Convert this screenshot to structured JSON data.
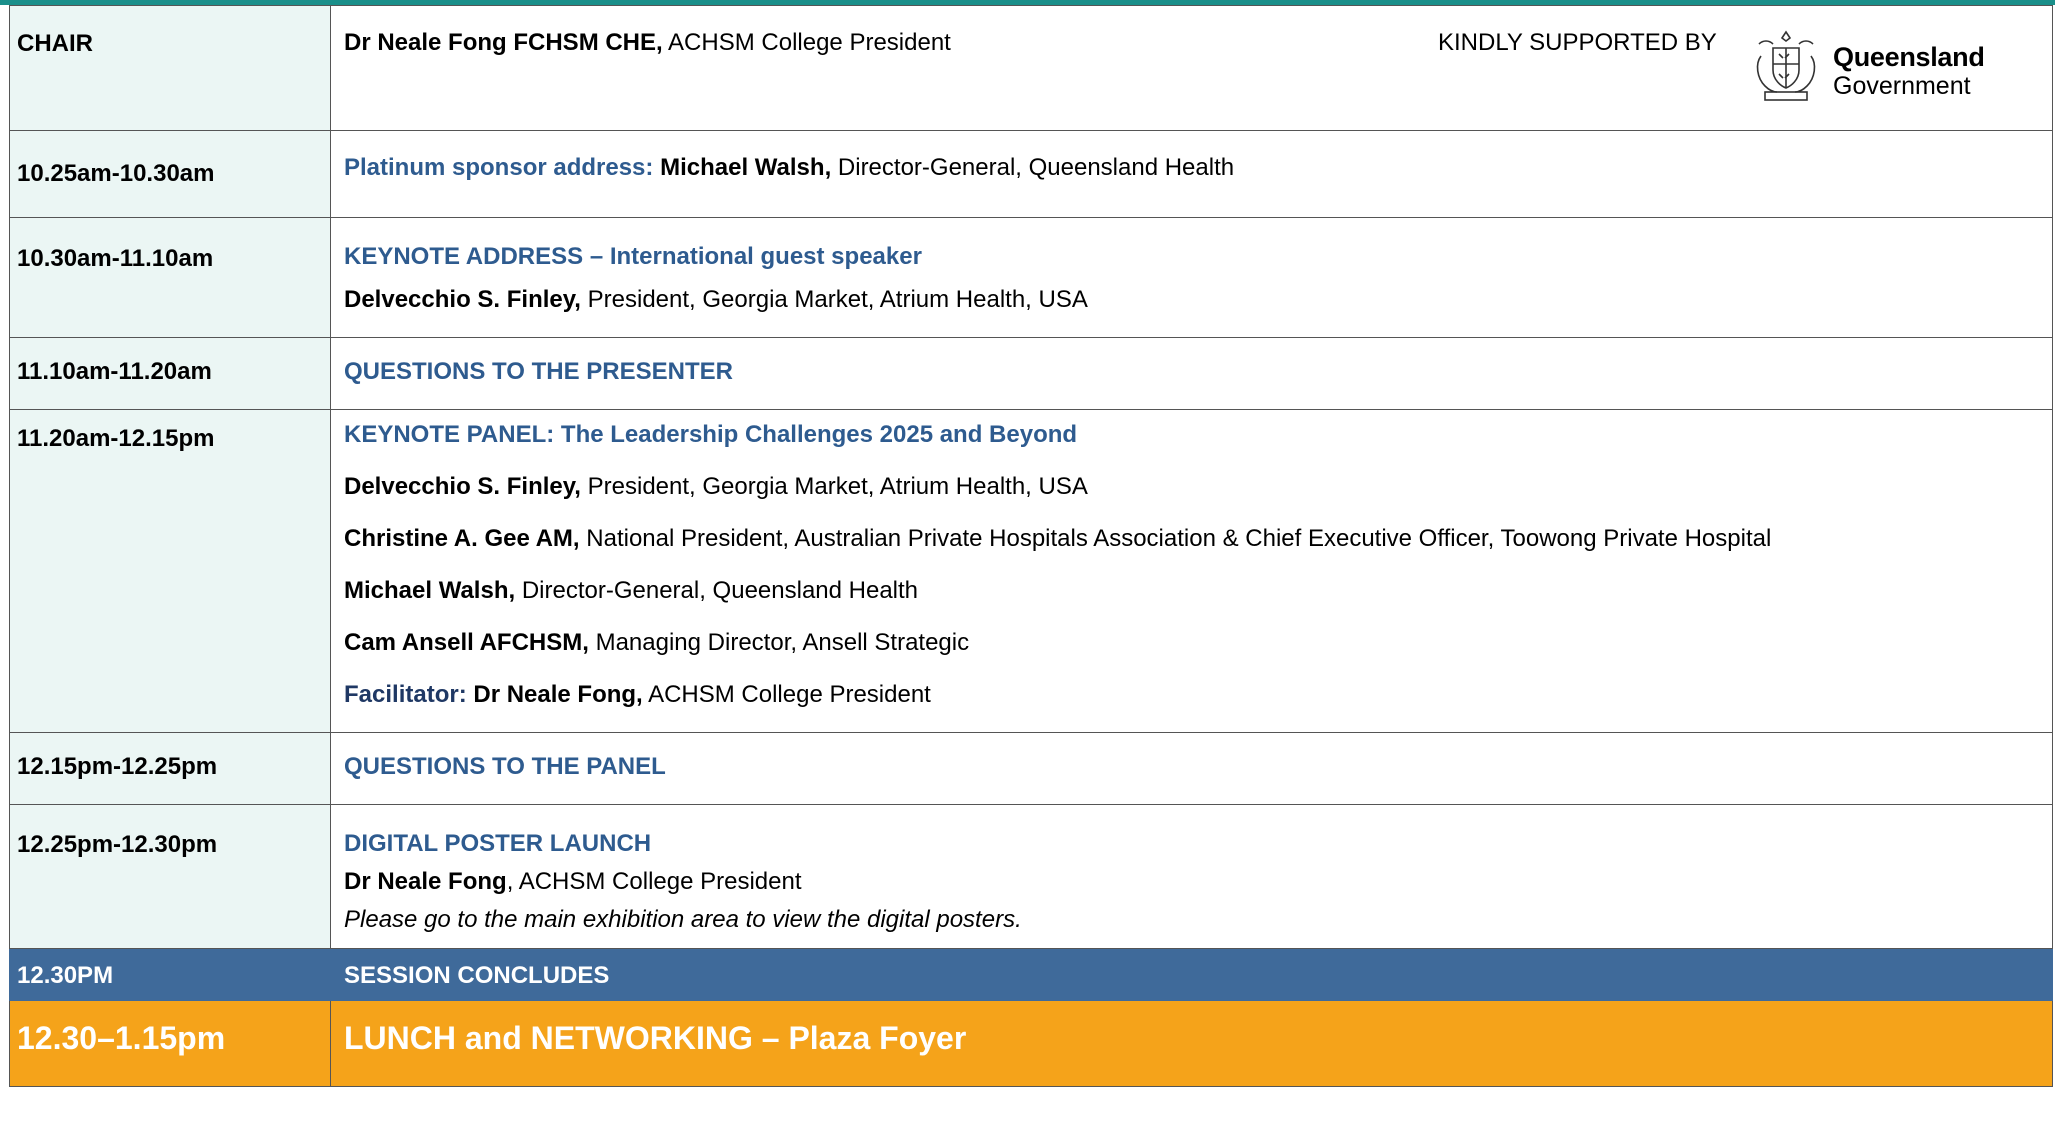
{
  "chair": {
    "label": "CHAIR",
    "name": "Dr Neale Fong FCHSM CHE,",
    "role": " ACHSM College President",
    "kindly": "KINDLY SUPPORTED BY",
    "sponsor_name": "Queensland",
    "sponsor_sub": "Government"
  },
  "rows": [
    {
      "time": "10.25am-10.30am",
      "l1_label": "Platinum sponsor address: ",
      "l1_name": "Michael Walsh,",
      "l1_role": " Director-General, Queensland Health"
    },
    {
      "time": "10.30am-11.10am",
      "title": "KEYNOTE ADDRESS – International guest speaker",
      "l1_name": "Delvecchio S. Finley,",
      "l1_role": " President, Georgia Market, Atrium Health, USA"
    },
    {
      "time": "11.10am-11.20am",
      "title": "QUESTIONS TO THE PRESENTER"
    },
    {
      "time": "11.20am-12.15pm",
      "title": "KEYNOTE PANEL: The Leadership Challenges 2025 and Beyond",
      "p1_name": "Delvecchio S. Finley,",
      "p1_role": " President, Georgia Market, Atrium Health, USA",
      "p2_name": "Christine A. Gee AM,",
      "p2_role": " National President, Australian Private Hospitals Association & Chief Executive Officer, Toowong Private Hospital",
      "p3_name": "Michael Walsh,",
      "p3_role": " Director-General, Queensland Health",
      "p4_name": "Cam Ansell AFCHSM,",
      "p4_role": " Managing Director, Ansell Strategic",
      "fac_label": "Facilitator: ",
      "fac_name": "Dr Neale Fong,",
      "fac_role": " ACHSM College President"
    },
    {
      "time": "12.15pm-12.25pm",
      "title": "QUESTIONS TO THE PANEL"
    },
    {
      "time": "12.25pm-12.30pm",
      "title": "DIGITAL POSTER LAUNCH",
      "l1_name": "Dr Neale Fong",
      "l1_role": ", ACHSM College President",
      "note": "Please go to the main exhibition area to view the digital posters."
    }
  ],
  "conclude": {
    "time": "12.30PM",
    "text": "SESSION CONCLUDES"
  },
  "lunch": {
    "time": "12.30–1.15pm",
    "text": "LUNCH and NETWORKING – Plaza Foyer"
  },
  "colors": {
    "teal_bar": "#1a8f8a",
    "time_col": "#ebf6f4",
    "title_blue": "#2e5b8f",
    "conclude_bg": "#3f6a9a",
    "lunch_bg": "#f5a31a"
  },
  "icons": {
    "sponsor_logo": "queensland-crest-icon"
  }
}
